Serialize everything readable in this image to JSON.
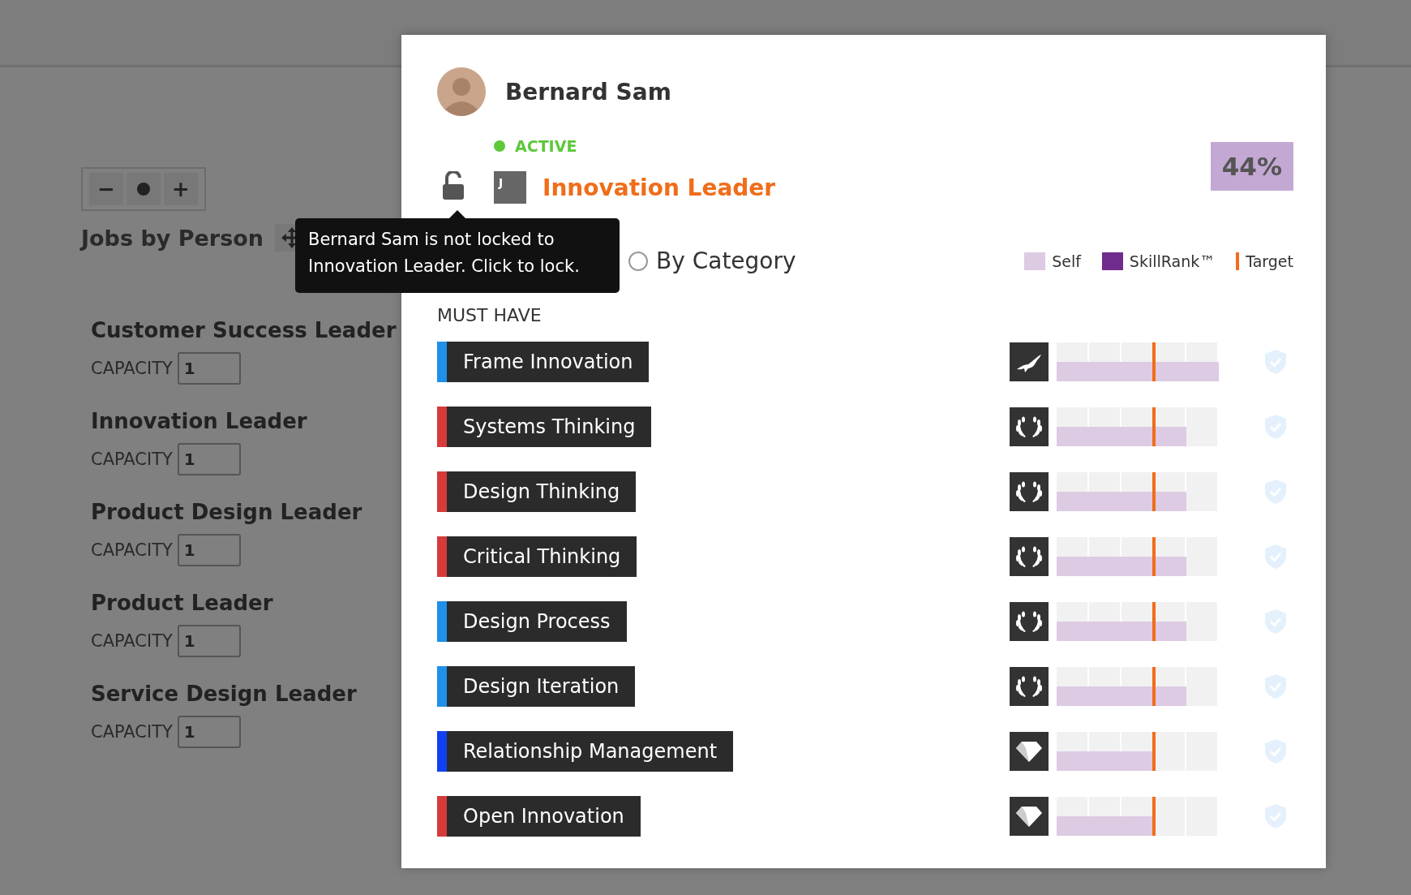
{
  "background": {
    "zoom_controls": {
      "zoom_out": "−",
      "zoom_in": "+"
    },
    "section_title": "Jobs by Person",
    "jobs": [
      {
        "title": "Customer Success Leader",
        "capacity_label": "CAPACITY",
        "capacity": "1"
      },
      {
        "title": "Innovation Leader",
        "capacity_label": "CAPACITY",
        "capacity": "1"
      },
      {
        "title": "Product Design Leader",
        "capacity_label": "CAPACITY",
        "capacity": "1"
      },
      {
        "title": "Product Leader",
        "capacity_label": "CAPACITY",
        "capacity": "1"
      },
      {
        "title": "Service Design Leader",
        "capacity_label": "CAPACITY",
        "capacity": "1"
      }
    ]
  },
  "profile": {
    "name": "Bernard Sam",
    "status": "ACTIVE",
    "locked": false,
    "job_initial": "J",
    "job_title": "Innovation Leader",
    "match": "44%"
  },
  "tooltip": {
    "text": "Bernard Sam is not locked to Innovation Leader. Click to lock."
  },
  "view_options": [
    {
      "label": "By Category",
      "selected": false
    }
  ],
  "legend": [
    {
      "label": "Self",
      "kind": "swatch",
      "color": "#dccbe3"
    },
    {
      "label": "SkillRank™",
      "kind": "swatch",
      "color": "#6f2c8c"
    },
    {
      "label": "Target",
      "kind": "line",
      "color": "#f06d1a"
    }
  ],
  "section": "MUST HAVE",
  "skills": [
    {
      "name": "Frame Innovation",
      "color": "#1e90e8",
      "badge": {
        "kind": "eagle"
      },
      "level": 1.0,
      "target": {
        "level": 0.6
      }
    },
    {
      "name": "Systems Thinking",
      "color": "#d63a3a",
      "badge": {
        "kind": "laurel"
      },
      "level": 0.8,
      "target": {
        "level": 0.6
      }
    },
    {
      "name": "Design Thinking",
      "color": "#d63a3a",
      "badge": {
        "kind": "laurel"
      },
      "level": 0.8,
      "target": {
        "level": 0.6
      }
    },
    {
      "name": "Critical Thinking",
      "color": "#d63a3a",
      "badge": {
        "kind": "laurel"
      },
      "level": 0.8,
      "target": {
        "level": 0.6
      }
    },
    {
      "name": "Design Process",
      "color": "#1e90e8",
      "badge": {
        "kind": "laurel"
      },
      "level": 0.8,
      "target": {
        "level": 0.6
      }
    },
    {
      "name": "Design Iteration",
      "color": "#1e90e8",
      "badge": {
        "kind": "laurel"
      },
      "level": 0.8,
      "target": {
        "level": 0.6
      }
    },
    {
      "name": "Relationship Management",
      "color": "#1040f0",
      "badge": {
        "kind": "diamond"
      },
      "level": 0.6,
      "target": {
        "level": 0.6
      }
    },
    {
      "name": "Open Innovation",
      "color": "#d63a3a",
      "badge": {
        "kind": "diamond"
      },
      "level": 0.6,
      "target": {
        "level": 0.6
      }
    }
  ]
}
